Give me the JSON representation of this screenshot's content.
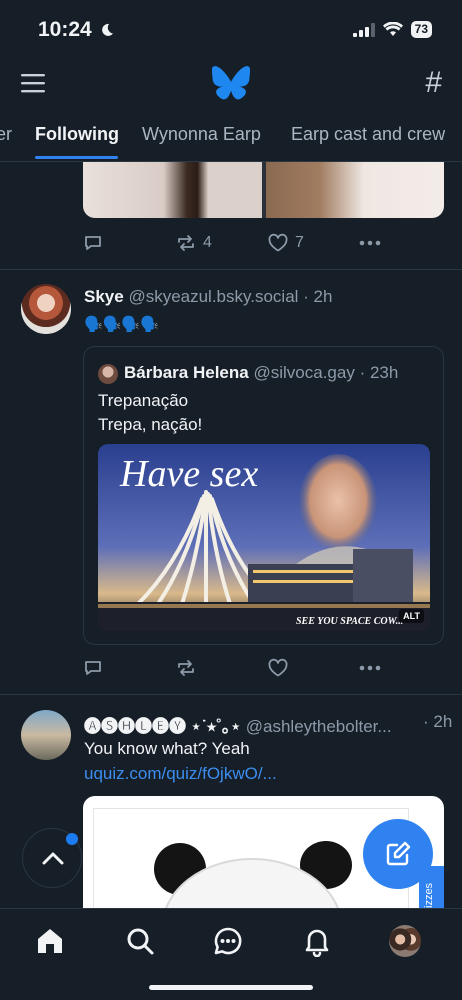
{
  "status_bar": {
    "time": "10:24",
    "battery": "73"
  },
  "tabs": [
    {
      "label": "er"
    },
    {
      "label": "Following"
    },
    {
      "label": "Wynonna Earp"
    },
    {
      "label": "Earp cast and crew"
    }
  ],
  "posts": [
    {
      "actions": {
        "replies": "",
        "reposts": "4",
        "likes": "7"
      }
    },
    {
      "author_name": "Skye",
      "author_handle": "@skyeazul.bsky.social",
      "time": "· 2h",
      "text": "🗣️🗣️🗣️🗣️",
      "quote": {
        "author_name": "Bárbara Helena",
        "author_handle": "@silvoca.gay",
        "time": "· 23h",
        "line1": "Trepanação",
        "line2": "Trepa, nação!",
        "image_caption": "Have sex",
        "image_subcaption": "SEE YOU SPACE COW...",
        "alt_badge": "ALT"
      }
    },
    {
      "author_name": "🅐🅢🅗🅛🅔🅨 ⋆˙⭒˚｡⋆",
      "author_handle": "@ashleythebolter...",
      "time": "· 2h",
      "text": "You know what? Yeah",
      "link": "uquiz.com/quiz/fOjkwO/...",
      "card_side_text": "izzes"
    }
  ],
  "colors": {
    "accent": "#2f82f0",
    "background": "#161e27",
    "link": "#3b8ef0",
    "muted": "#8c9aa9"
  },
  "icons": [
    "menu-icon",
    "bluesky-butterfly-logo",
    "hashtag-icon",
    "reply-icon",
    "repost-icon",
    "like-icon",
    "more-icon",
    "chevron-up-icon",
    "compose-icon",
    "home-icon",
    "search-icon",
    "chat-icon",
    "bell-icon"
  ]
}
